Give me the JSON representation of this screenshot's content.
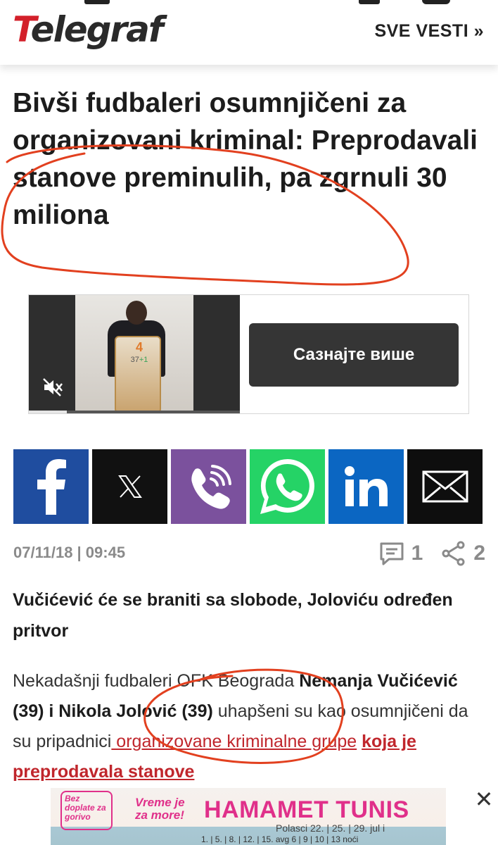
{
  "header": {
    "logo_first": "T",
    "logo_rest": "elegraf",
    "nav_link": "SVE VESTI »"
  },
  "article": {
    "headline": "Bivši fudbaleri osumnjičeni za organizovani kriminal: Preprodavali stanove preminulih, pa zgrnuli 30 miliona",
    "date": "07/11/18 | 09:45",
    "comments_count": "1",
    "shares_count": "2",
    "lead": "Vučićević će se braniti sa slobode, Joloviću određen pritvor",
    "body": {
      "t1": "Nekadašnji fudbaleri OFK Beograda ",
      "b1": "Nemanja Vučićević (39) i Nikola Jolović (39)",
      "t2": " uhapšeni su kao osumnjičeni da su pripadnici",
      "link1": " organizovane kriminalne grupe",
      "t3": " ",
      "link2": "koja je preprodavala stanove"
    }
  },
  "ad": {
    "cta": "Сазнајте више",
    "phone_number": "4",
    "phone_sub": "37",
    "phone_sub_plus": "+1",
    "progress": 0.18
  },
  "share": {
    "buttons": [
      "facebook-icon",
      "x-icon",
      "viber-icon",
      "whatsapp-icon",
      "linkedin-icon",
      "email-icon"
    ],
    "colors": {
      "facebook": "#1f4d9f",
      "x": "#111111",
      "viber": "#7b519d",
      "whatsapp": "#25d366",
      "linkedin": "#0b66c2",
      "email": "#0e0e0e"
    }
  },
  "bottom_ad": {
    "badge": "Bez doplate za gorivo",
    "tagline": "Vreme je za more!",
    "destination": "HAMAMET TUNIS",
    "departures": "Polasci 22. | 25. | 29. jul i",
    "dates": "1. | 5. | 8. | 12. | 15. avg 6 | 9 | 10 | 13 noći",
    "close": "✕"
  },
  "colors": {
    "brand_red": "#d3202a",
    "link_red": "#c0262c",
    "annotation_red": "#e2401f"
  }
}
